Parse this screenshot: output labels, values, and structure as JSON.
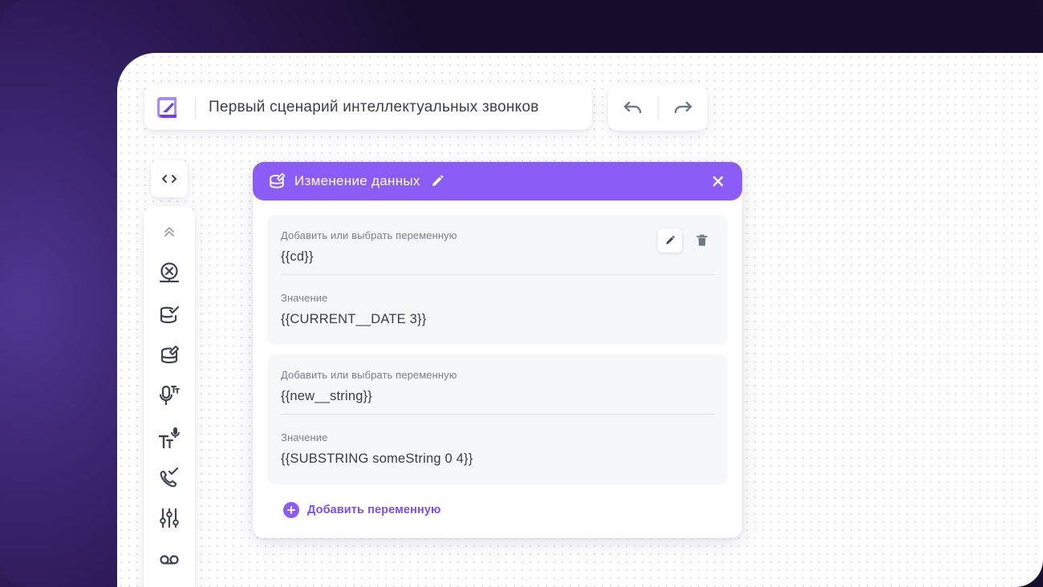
{
  "header": {
    "scenario_title": "Первый сценарий интеллектуальных звонков"
  },
  "history": {
    "undo_icon": "undo-icon",
    "redo_icon": "redo-icon"
  },
  "toolbar": {
    "code_toggle_icon": "code-brackets-icon",
    "items": [
      {
        "icon": "collapse-up-icon"
      },
      {
        "icon": "end-call-icon"
      },
      {
        "icon": "database-check-icon"
      },
      {
        "icon": "database-edit-icon"
      },
      {
        "icon": "speech-to-text-icon"
      },
      {
        "icon": "text-to-speech-icon"
      },
      {
        "icon": "call-check-icon"
      },
      {
        "icon": "sliders-icon"
      },
      {
        "icon": "voicemail-icon"
      }
    ]
  },
  "panel": {
    "title": "Изменение данных",
    "variables": [
      {
        "var_label": "Добавить или выбрать переменную",
        "var_value": "{{cd}}",
        "value_label": "Значение",
        "value_value": "{{CURRENT__DATE 3}}"
      },
      {
        "var_label": "Добавить или выбрать переменную",
        "var_value": "{{new__string}}",
        "value_label": "Значение",
        "value_value": "{{SUBSTRING someString 0 4}}"
      }
    ],
    "add_variable_label": "Добавить переменную"
  },
  "colors": {
    "accent": "#8b5cf6",
    "accent_text": "#7c4ef0",
    "icon_gray": "#3d4250",
    "muted_gray": "#6b7a86"
  }
}
